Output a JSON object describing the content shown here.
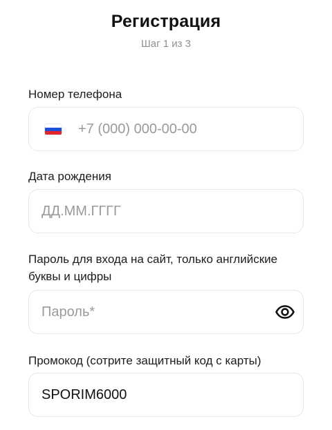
{
  "header": {
    "title": "Регистрация",
    "step": "Шаг 1 из 3"
  },
  "phone": {
    "label": "Номер телефона",
    "placeholder": "+7 (000) 000-00-00",
    "value": "",
    "flag_icon": "russia-flag-icon",
    "flag_colors": [
      "#ffffff",
      "#1f4fd6",
      "#e0262b"
    ]
  },
  "birthdate": {
    "label": "Дата рождения",
    "placeholder": "ДД.ММ.ГГГГ",
    "value": ""
  },
  "password": {
    "label": "Пароль для входа на сайт, только английские буквы и цифры",
    "placeholder": "Пароль*",
    "value": "",
    "toggle_icon": "eye-icon"
  },
  "promo": {
    "label": "Промокод (сотрите защитный код с карты)",
    "placeholder": "",
    "value": "SPORIM6000"
  }
}
